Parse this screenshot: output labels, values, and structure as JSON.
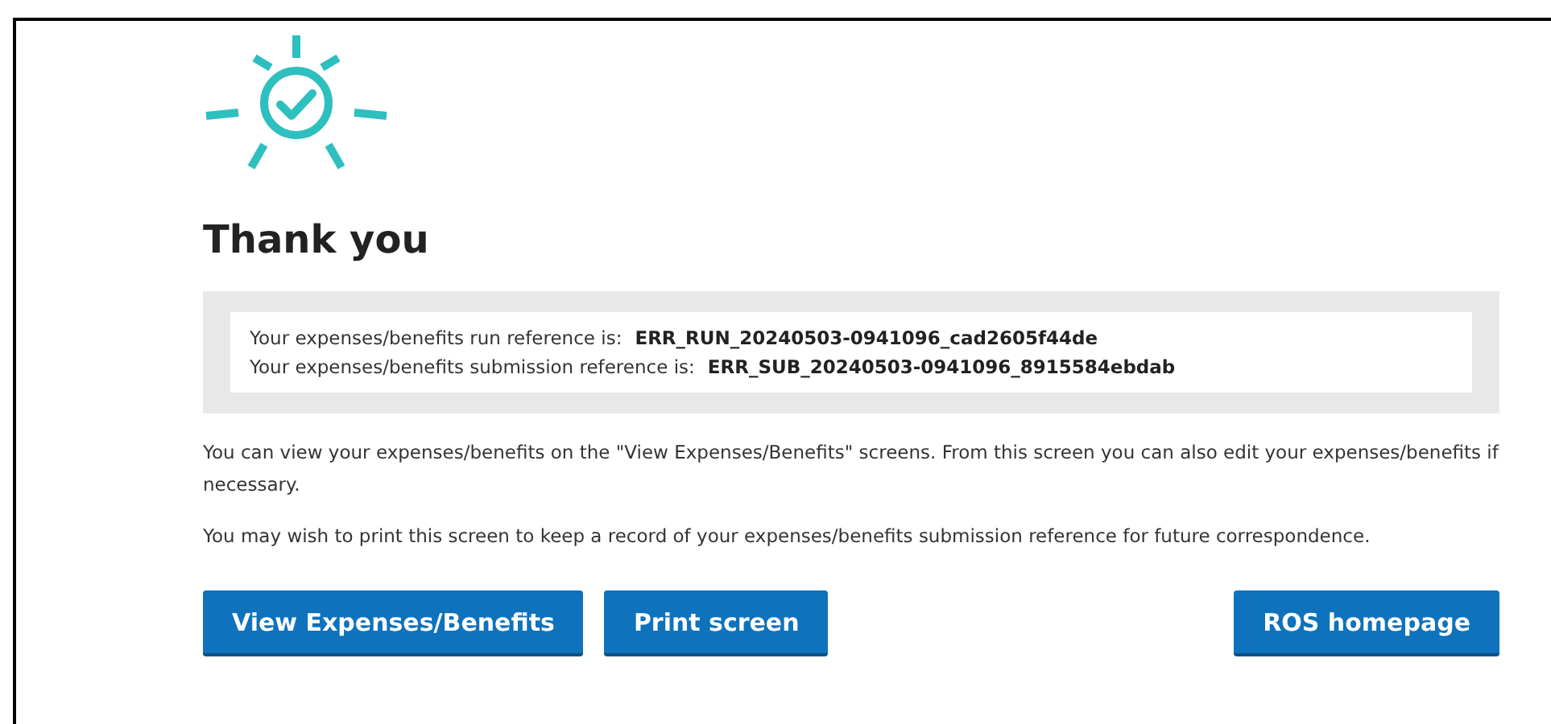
{
  "title": "Thank you",
  "references": [
    {
      "label": "Your expenses/benefits run reference is:",
      "value": "ERR_RUN_20240503-0941096_cad2605f44de"
    },
    {
      "label": "Your expenses/benefits submission reference is:",
      "value": "ERR_SUB_20240503-0941096_8915584ebdab"
    }
  ],
  "paragraphs": [
    "You can view your expenses/benefits on the \"View Expenses/Benefits\" screens. From this screen you can also edit your expenses/benefits if necessary.",
    "You may wish to print this screen to keep a record of your expenses/benefits submission reference for future correspondence."
  ],
  "buttons": [
    "View Expenses/Benefits",
    "Print screen",
    "ROS homepage"
  ]
}
